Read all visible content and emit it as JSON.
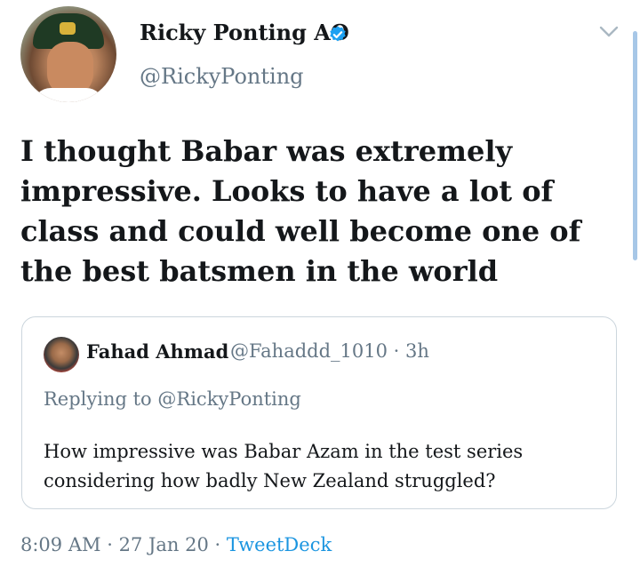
{
  "author": {
    "display_name": "Ricky Ponting AO",
    "handle": "@RickyPonting",
    "avatar_icon": "profile-photo",
    "verified_icon": "verified-badge-icon"
  },
  "tweet": {
    "text": "I thought Babar was extremely impressive. Looks to have a lot of class and could well become one of the best batsmen in the world"
  },
  "quoted_tweet": {
    "display_name": "Fahad Ahmad",
    "handle": "@Fahaddd_1010",
    "separator": "·",
    "age": "3h",
    "replying_prefix": "Replying to",
    "replying_to": "@RickyPonting",
    "text": "How impressive was Babar Azam in the test series considering how badly New Zealand struggled?"
  },
  "footer": {
    "time": "8:09 AM",
    "separator": "·",
    "date": "27 Jan 20",
    "source": "TweetDeck"
  },
  "colors": {
    "text_primary": "#14171a",
    "text_secondary": "#657786",
    "link": "#1b95e0",
    "verified": "#1da1f2",
    "border": "#ccd6dd"
  }
}
